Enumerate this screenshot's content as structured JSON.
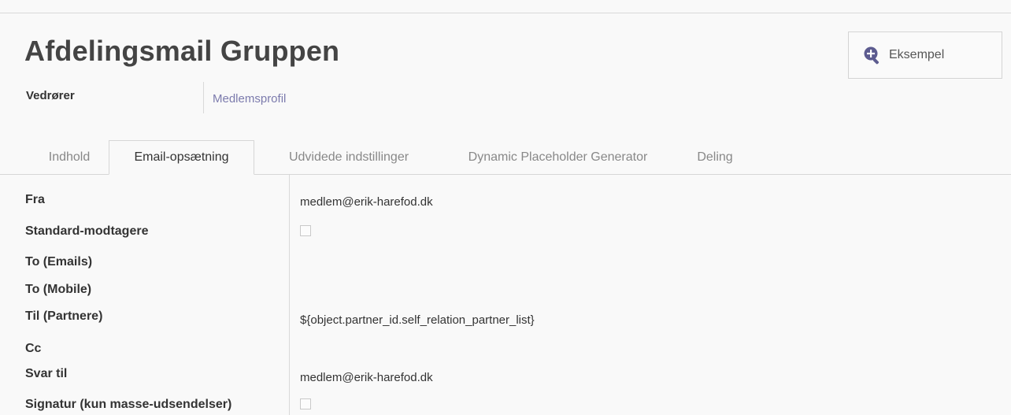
{
  "record": {
    "title": "Afdelingsmail Gruppen",
    "preview_label": "Eksempel",
    "related_label": "Vedrører",
    "related_value": "Medlemsprofil"
  },
  "tabs": [
    {
      "label": "Indhold"
    },
    {
      "label": "Email-opsætning",
      "active": true
    },
    {
      "label": "Udvidede indstillinger"
    },
    {
      "label": "Dynamic Placeholder Generator"
    },
    {
      "label": "Deling"
    }
  ],
  "form": {
    "fra": {
      "label": "Fra",
      "value": "medlem@erik-harefod.dk"
    },
    "standard_modtagere": {
      "label": "Standard-modtagere",
      "checked": false
    },
    "to_emails": {
      "label": "To (Emails)",
      "value": ""
    },
    "to_mobile": {
      "label": "To (Mobile)",
      "value": ""
    },
    "til_partnere": {
      "label": "Til (Partnere)",
      "value": "${object.partner_id.self_relation_partner_list}"
    },
    "cc": {
      "label": "Cc",
      "value": ""
    },
    "svar_til": {
      "label": "Svar til",
      "value": "medlem@erik-harefod.dk"
    },
    "signatur": {
      "label": "Signatur (kun masse-udsendelser)",
      "checked": false
    }
  },
  "colors": {
    "accent_link": "#7c7bad",
    "preview_icon": "#5c5b8f"
  },
  "icons": {
    "preview": "zoom-in-icon"
  }
}
